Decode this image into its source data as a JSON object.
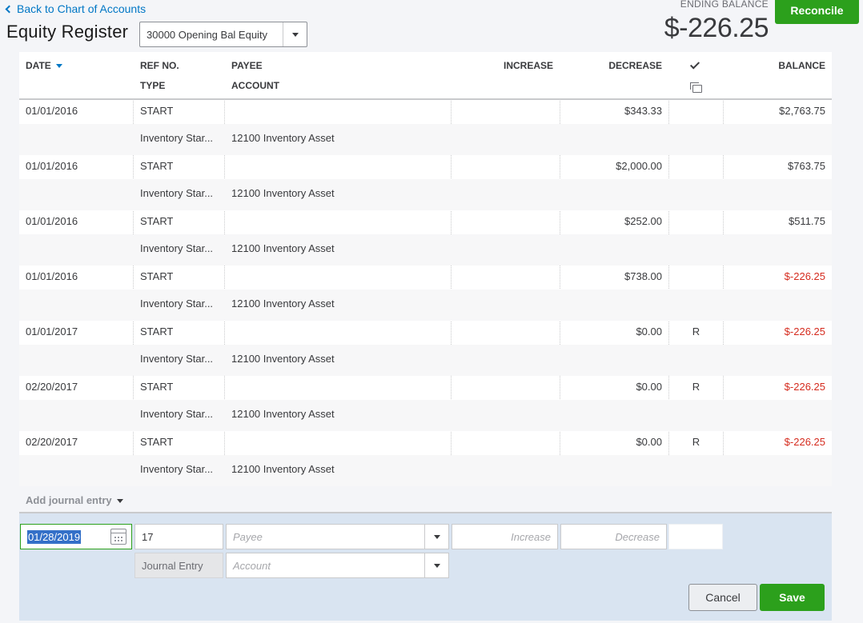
{
  "header": {
    "back_link": "Back to Chart of Accounts",
    "title": "Equity Register",
    "account_selected": "30000 Opening Bal Equity",
    "ending_balance_label": "ENDING BALANCE",
    "ending_balance_value": "$-226.25",
    "reconcile_label": "Reconcile"
  },
  "columns": {
    "date": "DATE",
    "ref_no": "REF NO.",
    "type": "TYPE",
    "payee": "PAYEE",
    "account": "ACCOUNT",
    "increase": "INCREASE",
    "decrease": "DECREASE",
    "balance": "BALANCE"
  },
  "rows": [
    {
      "date": "01/01/2016",
      "ref": "START",
      "type": "Inventory Star...",
      "account": "12100 Inventory Asset",
      "decrease": "$343.33",
      "reconciled": "",
      "balance": "$2,763.75"
    },
    {
      "date": "01/01/2016",
      "ref": "START",
      "type": "Inventory Star...",
      "account": "12100 Inventory Asset",
      "decrease": "$2,000.00",
      "reconciled": "",
      "balance": "$763.75"
    },
    {
      "date": "01/01/2016",
      "ref": "START",
      "type": "Inventory Star...",
      "account": "12100 Inventory Asset",
      "decrease": "$252.00",
      "reconciled": "",
      "balance": "$511.75"
    },
    {
      "date": "01/01/2016",
      "ref": "START",
      "type": "Inventory Star...",
      "account": "12100 Inventory Asset",
      "decrease": "$738.00",
      "reconciled": "",
      "balance": "$-226.25"
    },
    {
      "date": "01/01/2017",
      "ref": "START",
      "type": "Inventory Star...",
      "account": "12100 Inventory Asset",
      "decrease": "$0.00",
      "reconciled": "R",
      "balance": "$-226.25"
    },
    {
      "date": "02/20/2017",
      "ref": "START",
      "type": "Inventory Star...",
      "account": "12100 Inventory Asset",
      "decrease": "$0.00",
      "reconciled": "R",
      "balance": "$-226.25"
    },
    {
      "date": "02/20/2017",
      "ref": "START",
      "type": "Inventory Star...",
      "account": "12100 Inventory Asset",
      "decrease": "$0.00",
      "reconciled": "R",
      "balance": "$-226.25"
    }
  ],
  "add_journal_entry": "Add journal entry",
  "edit_row": {
    "date_value": "01/28/2019",
    "ref_value": "17",
    "type_value": "Journal Entry",
    "payee_placeholder": "Payee",
    "account_placeholder": "Account",
    "increase_placeholder": "Increase",
    "decrease_placeholder": "Decrease",
    "cancel_label": "Cancel",
    "save_label": "Save"
  },
  "colors": {
    "brand_green": "#2ca01c",
    "link_blue": "#0077c5",
    "negative_red": "#d52b1e"
  }
}
